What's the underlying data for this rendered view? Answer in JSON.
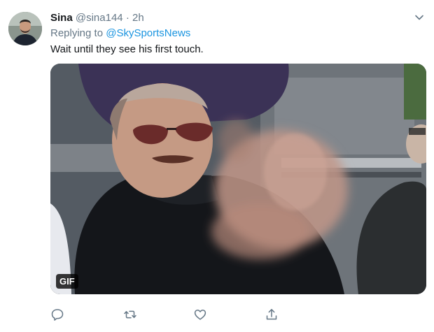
{
  "tweet": {
    "display_name": "Sina",
    "handle": "@sina144",
    "separator": "·",
    "time": "2h",
    "replying_prefix": "Replying to",
    "replying_to": "@SkySportsNews",
    "text": "Wait until they see his first touch.",
    "media_badge": "GIF"
  },
  "icons": {
    "avatar": "user-avatar",
    "menu": "chevron-down-icon",
    "reply": "reply-icon",
    "retweet": "retweet-icon",
    "like": "heart-icon",
    "share": "share-icon"
  },
  "colors": {
    "link": "#1b95e0",
    "secondary_text": "#657786",
    "primary_text": "#14171a"
  }
}
